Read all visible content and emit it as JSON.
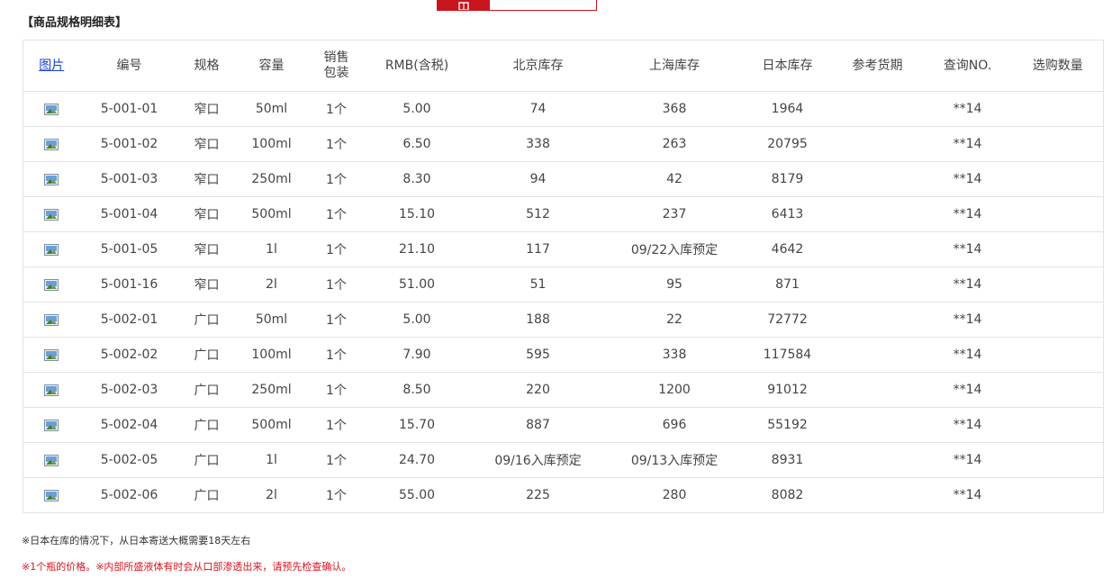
{
  "section_title": "【商品规格明细表】",
  "colors": {
    "accent_red": "#d9141e",
    "link_blue": "#1a3fd6",
    "border": "#e3e3e3"
  },
  "table": {
    "headers": {
      "image": "图片",
      "code": "编号",
      "spec": "规格",
      "capacity": "容量",
      "pack_line1": "销售",
      "pack_line2": "包装",
      "price": "RMB(含税)",
      "beijing": "北京库存",
      "shanghai": "上海库存",
      "japan": "日本库存",
      "delivery": "参考货期",
      "query": "查询NO.",
      "quantity": "选购数量"
    },
    "rows": [
      {
        "code": "5-001-01",
        "spec": "窄口",
        "capacity": "50ml",
        "pack": "1个",
        "price": "5.00",
        "beijing": "74",
        "shanghai": "368",
        "japan": "1964",
        "delivery": "",
        "query": "**14"
      },
      {
        "code": "5-001-02",
        "spec": "窄口",
        "capacity": "100ml",
        "pack": "1个",
        "price": "6.50",
        "beijing": "338",
        "shanghai": "263",
        "japan": "20795",
        "delivery": "",
        "query": "**14"
      },
      {
        "code": "5-001-03",
        "spec": "窄口",
        "capacity": "250ml",
        "pack": "1个",
        "price": "8.30",
        "beijing": "94",
        "shanghai": "42",
        "japan": "8179",
        "delivery": "",
        "query": "**14"
      },
      {
        "code": "5-001-04",
        "spec": "窄口",
        "capacity": "500ml",
        "pack": "1个",
        "price": "15.10",
        "beijing": "512",
        "shanghai": "237",
        "japan": "6413",
        "delivery": "",
        "query": "**14"
      },
      {
        "code": "5-001-05",
        "spec": "窄口",
        "capacity": "1l",
        "pack": "1个",
        "price": "21.10",
        "beijing": "117",
        "shanghai": "09/22入库预定",
        "japan": "4642",
        "delivery": "",
        "query": "**14"
      },
      {
        "code": "5-001-16",
        "spec": "窄口",
        "capacity": "2l",
        "pack": "1个",
        "price": "51.00",
        "beijing": "51",
        "shanghai": "95",
        "japan": "871",
        "delivery": "",
        "query": "**14"
      },
      {
        "code": "5-002-01",
        "spec": "广口",
        "capacity": "50ml",
        "pack": "1个",
        "price": "5.00",
        "beijing": "188",
        "shanghai": "22",
        "japan": "72772",
        "delivery": "",
        "query": "**14"
      },
      {
        "code": "5-002-02",
        "spec": "广口",
        "capacity": "100ml",
        "pack": "1个",
        "price": "7.90",
        "beijing": "595",
        "shanghai": "338",
        "japan": "117584",
        "delivery": "",
        "query": "**14"
      },
      {
        "code": "5-002-03",
        "spec": "广口",
        "capacity": "250ml",
        "pack": "1个",
        "price": "8.50",
        "beijing": "220",
        "shanghai": "1200",
        "japan": "91012",
        "delivery": "",
        "query": "**14"
      },
      {
        "code": "5-002-04",
        "spec": "广口",
        "capacity": "500ml",
        "pack": "1个",
        "price": "15.70",
        "beijing": "887",
        "shanghai": "696",
        "japan": "55192",
        "delivery": "",
        "query": "**14"
      },
      {
        "code": "5-002-05",
        "spec": "广口",
        "capacity": "1l",
        "pack": "1个",
        "price": "24.70",
        "beijing": "09/16入库预定",
        "shanghai": "09/13入库预定",
        "japan": "8931",
        "delivery": "",
        "query": "**14"
      },
      {
        "code": "5-002-06",
        "spec": "广口",
        "capacity": "2l",
        "pack": "1个",
        "price": "55.00",
        "beijing": "225",
        "shanghai": "280",
        "japan": "8082",
        "delivery": "",
        "query": "**14"
      }
    ]
  },
  "notes": {
    "shipping": "※日本在库的情况下，从日本寄送大概需要18天左右",
    "warning": "※1个瓶的价格。※内部所盛液体有时会从口部渗透出来，请预先检查确认。"
  }
}
